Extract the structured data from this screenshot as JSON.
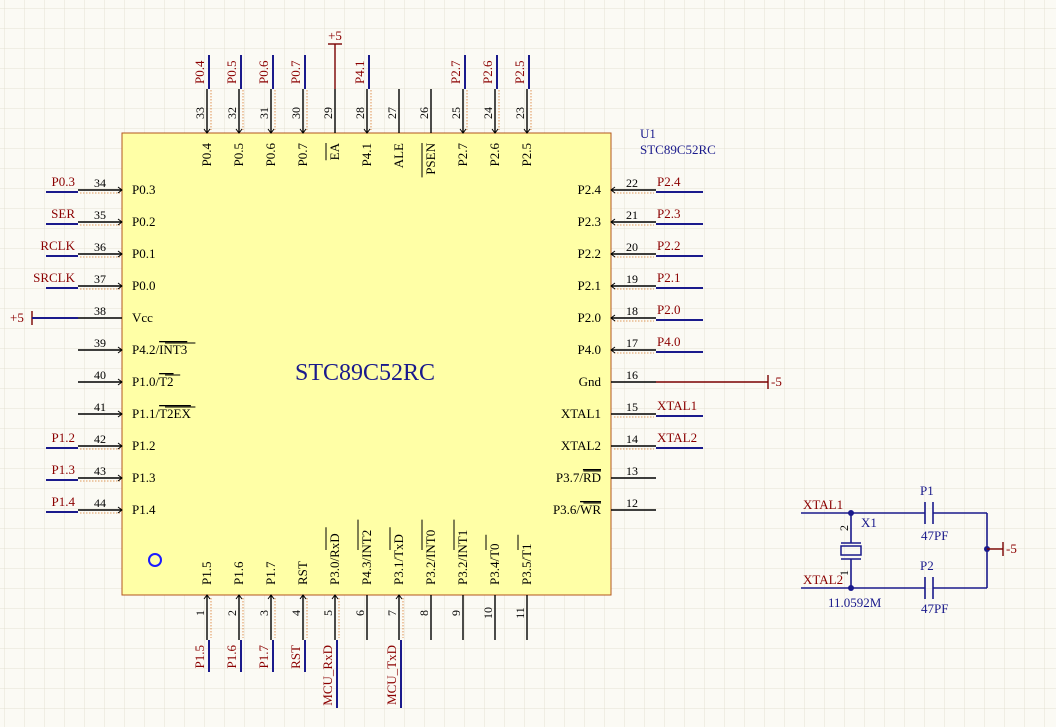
{
  "chip": {
    "designator": "U1",
    "part": "STC89C52RC",
    "center_label": "STC89C52RC"
  },
  "power": {
    "vcc": "+5",
    "gnd": "-5"
  },
  "pins_top": [
    {
      "num": "33",
      "name": "P0.4",
      "net": "P0.4"
    },
    {
      "num": "32",
      "name": "P0.5",
      "net": "P0.5"
    },
    {
      "num": "31",
      "name": "P0.6",
      "net": "P0.6"
    },
    {
      "num": "30",
      "name": "P0.7",
      "net": "P0.7"
    },
    {
      "num": "29",
      "name": "EA",
      "net": "+5",
      "overbar": true,
      "power": true
    },
    {
      "num": "28",
      "name": "P4.1",
      "net": "P4.1"
    },
    {
      "num": "27",
      "name": "ALE",
      "net": ""
    },
    {
      "num": "26",
      "name": "PSEN",
      "net": "",
      "overbar": true
    },
    {
      "num": "25",
      "name": "P2.7",
      "net": "P2.7"
    },
    {
      "num": "24",
      "name": "P2.6",
      "net": "P2.6"
    },
    {
      "num": "23",
      "name": "P2.5",
      "net": "P2.5"
    }
  ],
  "pins_left": [
    {
      "num": "34",
      "name": "P0.3",
      "net": "P0.3"
    },
    {
      "num": "35",
      "name": "P0.2",
      "net": "SER"
    },
    {
      "num": "36",
      "name": "P0.1",
      "net": "RCLK"
    },
    {
      "num": "37",
      "name": "P0.0",
      "net": "SRCLK"
    },
    {
      "num": "38",
      "name": "Vcc",
      "net": "+5",
      "power": true
    },
    {
      "num": "39",
      "name": "P4.2/INT3",
      "net": ""
    },
    {
      "num": "40",
      "name": "P1.0/T2",
      "net": ""
    },
    {
      "num": "41",
      "name": "P1.1/T2EX",
      "net": ""
    },
    {
      "num": "42",
      "name": "P1.2",
      "net": "P1.2"
    },
    {
      "num": "43",
      "name": "P1.3",
      "net": "P1.3"
    },
    {
      "num": "44",
      "name": "P1.4",
      "net": "P1.4"
    }
  ],
  "pins_right": [
    {
      "num": "22",
      "name": "P2.4",
      "net": "P2.4"
    },
    {
      "num": "21",
      "name": "P2.3",
      "net": "P2.3"
    },
    {
      "num": "20",
      "name": "P2.2",
      "net": "P2.2"
    },
    {
      "num": "19",
      "name": "P2.1",
      "net": "P2.1"
    },
    {
      "num": "18",
      "name": "P2.0",
      "net": "P2.0"
    },
    {
      "num": "17",
      "name": "P4.0",
      "net": "P4.0"
    },
    {
      "num": "16",
      "name": "Gnd",
      "net": "-5",
      "power": true
    },
    {
      "num": "15",
      "name": "XTAL1",
      "net": "XTAL1"
    },
    {
      "num": "14",
      "name": "XTAL2",
      "net": "XTAL2"
    },
    {
      "num": "13",
      "name": "P3.7/RD",
      "net": ""
    },
    {
      "num": "12",
      "name": "P3.6/WR",
      "net": ""
    }
  ],
  "pins_bottom": [
    {
      "num": "1",
      "name": "P1.5",
      "net": "P1.5"
    },
    {
      "num": "2",
      "name": "P1.6",
      "net": "P1.6"
    },
    {
      "num": "3",
      "name": "P1.7",
      "net": "P1.7"
    },
    {
      "num": "4",
      "name": "RST",
      "net": "RST"
    },
    {
      "num": "5",
      "name": "P3.0/RxD",
      "net": "MCU_RxD"
    },
    {
      "num": "6",
      "name": "P4.3/INT2",
      "net": ""
    },
    {
      "num": "7",
      "name": "P3.1/TxD",
      "net": "MCU_TxD"
    },
    {
      "num": "8",
      "name": "P3.2/INT0",
      "net": ""
    },
    {
      "num": "9",
      "name": "P3.2/INT1",
      "net": ""
    },
    {
      "num": "10",
      "name": "P3.4/T0",
      "net": ""
    },
    {
      "num": "11",
      "name": "P3.5/T1",
      "net": ""
    }
  ],
  "crystal": {
    "xtal1_net": "XTAL1",
    "xtal2_net": "XTAL2",
    "designator": "X1",
    "value": "11.0592M",
    "pin_top": "2",
    "pin_bottom": "1",
    "cap1_name": "P1",
    "cap1_value": "47PF",
    "cap2_name": "P2",
    "cap2_value": "47PF",
    "gnd": "-5"
  }
}
